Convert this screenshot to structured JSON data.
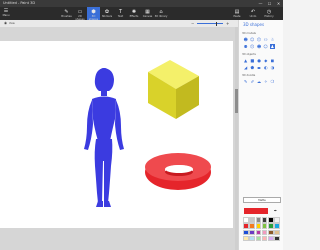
{
  "window": {
    "app_title": "Untitled - Paint 3D",
    "min": "—",
    "max": "☐",
    "close": "✕"
  },
  "menu": {
    "label": "Menu",
    "icon": "hamburger-icon"
  },
  "toolbar": {
    "tools": [
      {
        "label": "Brushes",
        "icon": "brush-icon",
        "glyph": "✎"
      },
      {
        "label": "2D shapes",
        "icon": "shapes-2d-icon",
        "glyph": "▭"
      },
      {
        "label": "3D shapes",
        "icon": "cube-icon",
        "glyph": "⬢",
        "active": true
      },
      {
        "label": "Stickers",
        "icon": "sticker-icon",
        "glyph": "✿"
      },
      {
        "label": "Text",
        "icon": "text-icon",
        "glyph": "T"
      },
      {
        "label": "Effects",
        "icon": "effects-icon",
        "glyph": "✺"
      },
      {
        "label": "Canvas",
        "icon": "canvas-icon",
        "glyph": "▦"
      },
      {
        "label": "3D library",
        "icon": "library-icon",
        "glyph": "⌂"
      }
    ],
    "right": [
      {
        "label": "Paste",
        "icon": "paste-icon",
        "glyph": "▤"
      },
      {
        "label": "Undo",
        "icon": "undo-icon",
        "glyph": "↶"
      },
      {
        "label": "History",
        "icon": "history-icon",
        "glyph": "◷"
      }
    ],
    "zoom_value": 0.72
  },
  "panel": {
    "title": "3D shapes",
    "section1": "3D models",
    "section2": "3D objects",
    "section3": "3D doodle",
    "models_row1": [
      "☻",
      "☺",
      "☹",
      "⚇",
      "☃"
    ],
    "models_row2": [
      "⚉",
      "☹",
      "☻",
      "☺",
      "♟"
    ],
    "objects_row1": [
      "▲",
      "■",
      "●",
      "◆",
      "◼"
    ],
    "objects_row2": [
      "◢",
      "⬟",
      "⬬",
      "◐",
      "◑"
    ],
    "doodle_row": [
      "✎",
      "✐",
      "☁",
      "✧",
      "❍"
    ],
    "material": "Matte",
    "current_color": "#e5252b",
    "swatches": [
      "#ffffff",
      "#c8c8c8",
      "#8a8a8a",
      "#3c3c3c",
      "#000000",
      "#f0f0f0",
      "#e5252b",
      "#f47b20",
      "#ffd200",
      "#7fc242",
      "#2b9f3a",
      "#1aa7df",
      "#1e4fd6",
      "#6a3cc4",
      "#b63aa5",
      "#f29abf",
      "#8b5a2b",
      "#e0c090",
      "#ffe9a8",
      "#b5e0f5",
      "#a6e3a1",
      "#ffb3b3",
      "#d8a8f0",
      "#333333"
    ]
  },
  "canvas": {
    "objects": [
      {
        "name": "woman-model",
        "color": "#3b3be0"
      },
      {
        "name": "cube",
        "color": "#e8e437"
      },
      {
        "name": "torus",
        "color": "#e5252b"
      }
    ]
  }
}
